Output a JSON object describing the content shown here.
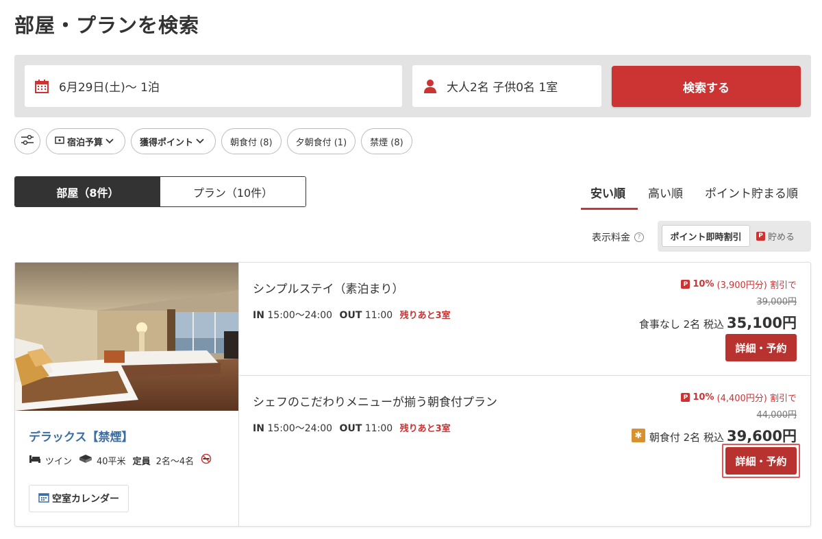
{
  "page": {
    "title": "部屋・プランを検索"
  },
  "search": {
    "date_value": "6月29日(土)〜 1泊",
    "guests_value": "大人2名 子供0名 1室",
    "submit_label": "検索する"
  },
  "filters": {
    "budget_label": "宿泊予算",
    "points_label": "獲得ポイント",
    "chips": [
      "朝食付 (8)",
      "夕朝食付 (1)",
      "禁煙 (8)"
    ]
  },
  "tabs": {
    "rooms": "部屋（8件）",
    "plans": "プラン（10件）"
  },
  "sort": {
    "options": [
      "安い順",
      "高い順",
      "ポイント貯まる順"
    ],
    "active": "安い順"
  },
  "price_display": {
    "label": "表示料金",
    "on_option": "ポイント即時割引",
    "off_option": "貯める"
  },
  "room": {
    "name": "デラックス【禁煙】",
    "bed": "ツイン",
    "size": "40平米",
    "capacity_label": "定員",
    "capacity_value": "2名〜4名",
    "calendar_label": "空室カレンダー"
  },
  "plans": [
    {
      "name": "シンプルステイ（素泊まり）",
      "in_label": "IN",
      "in_time": "15:00〜24:00",
      "out_label": "OUT",
      "out_time": "11:00",
      "rooms_left": "残りあと3室",
      "discount_pct": "10%",
      "discount_detail": "(3,900円分) 割引で",
      "original_price": "39,000円",
      "meal_text": "食事なし 2名 税込",
      "price": "35,100円",
      "button_label": "詳細・予約"
    },
    {
      "name": "シェフのこだわりメニューが揃う朝食付プラン",
      "in_label": "IN",
      "in_time": "15:00〜24:00",
      "out_label": "OUT",
      "out_time": "11:00",
      "rooms_left": "残りあと3室",
      "discount_pct": "10%",
      "discount_detail": "(4,400円分) 割引で",
      "original_price": "44,000円",
      "meal_text": "朝食付 2名 税込",
      "price": "39,600円",
      "button_label": "詳細・予約"
    }
  ],
  "icons": {
    "calendar": "calendar-icon",
    "person": "person-icon",
    "filter": "filter-sliders-icon",
    "wallet": "wallet-icon",
    "bed": "bed-icon",
    "size": "floor-area-icon",
    "no_smoking": "no-smoking-icon",
    "points": "points-badge-icon",
    "breakfast": "breakfast-icon"
  },
  "colors": {
    "accent": "#cc3333",
    "room_name": "#3a6ea5",
    "button": "#b8322f"
  }
}
